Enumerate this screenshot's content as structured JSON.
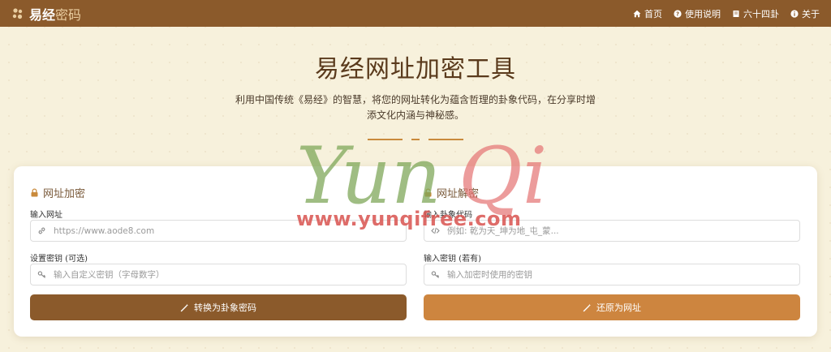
{
  "header": {
    "brand_main": "易经",
    "brand_sub": "密码",
    "nav": [
      {
        "label": "首页",
        "icon": "home-icon"
      },
      {
        "label": "使用说明",
        "icon": "question-circle-icon"
      },
      {
        "label": "六十四卦",
        "icon": "book-icon"
      },
      {
        "label": "关于",
        "icon": "info-circle-icon"
      }
    ]
  },
  "hero": {
    "title": "易经网址加密工具",
    "description": "利用中国传统《易经》的智慧，将您的网址转化为蕴含哲理的卦象代码，在分享时增添文化内涵与神秘感。"
  },
  "watermark": {
    "script_text": "Yun Qi",
    "url_text": "www.yunqifree.com"
  },
  "encrypt": {
    "title": "网址加密",
    "url_label": "输入网址",
    "url_placeholder": "https://www.aode8.com",
    "key_label": "设置密钥 (可选)",
    "key_placeholder": "输入自定义密钥（字母数字）",
    "button_label": "转换为卦象密码"
  },
  "decrypt": {
    "title": "网址解密",
    "code_label": "输入卦象代码",
    "code_placeholder": "例如: 乾为天_坤为地_屯_蒙...",
    "key_label": "输入密钥 (若有)",
    "key_placeholder": "输入加密时使用的密钥",
    "button_label": "还原为网址"
  },
  "colors": {
    "header_bg": "#8b5a2b",
    "page_bg": "#f7f1dc",
    "encrypt_button": "#8b5a2b",
    "decrypt_button": "#cd853f",
    "accent": "#c98a3c"
  }
}
